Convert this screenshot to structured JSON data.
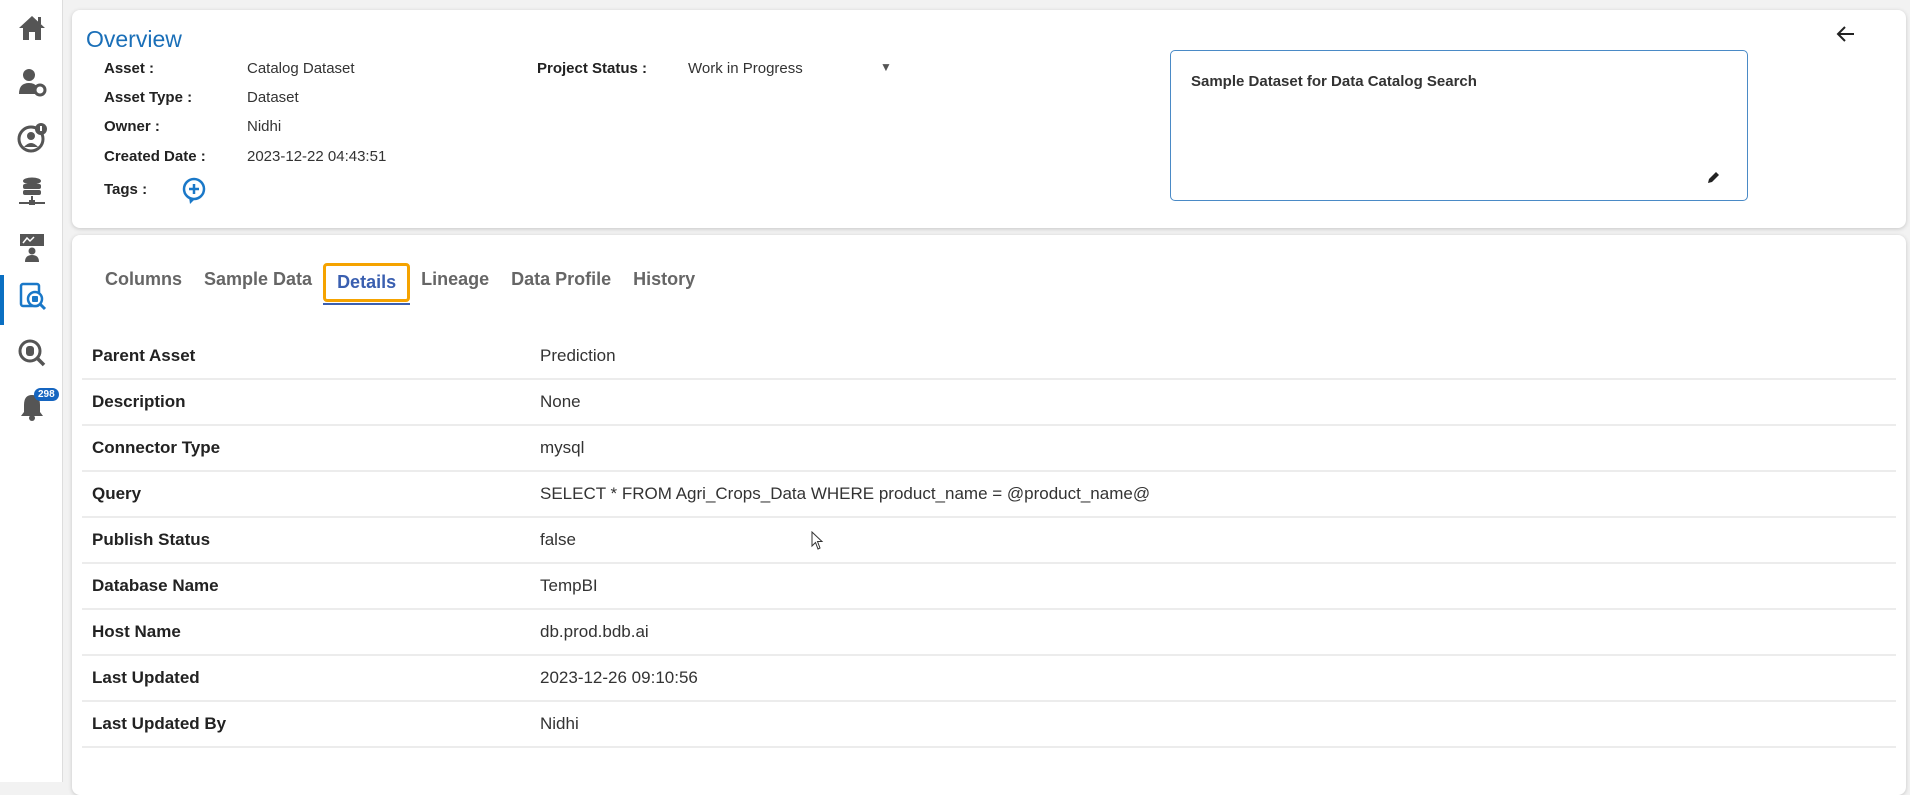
{
  "sidebar": {
    "items": [
      {
        "name": "home-icon"
      },
      {
        "name": "user-settings-icon"
      },
      {
        "name": "user-alert-icon"
      },
      {
        "name": "database-network-icon"
      },
      {
        "name": "dashboard-presenter-icon"
      },
      {
        "name": "data-catalog-icon",
        "active": true
      },
      {
        "name": "data-search-icon"
      },
      {
        "name": "notification-bell-icon"
      }
    ],
    "notification_count": "298"
  },
  "overview": {
    "title": "Overview",
    "asset_label": "Asset :",
    "asset_value": "Catalog Dataset",
    "asset_type_label": "Asset Type :",
    "asset_type_value": "Dataset",
    "owner_label": "Owner :",
    "owner_value": "Nidhi",
    "created_label": "Created Date :",
    "created_value": "2023-12-22 04:43:51",
    "tags_label": "Tags :",
    "project_status_label": "Project Status :",
    "project_status_value": "Work in Progress",
    "description_text": "Sample Dataset for Data Catalog Search"
  },
  "tabs": [
    "Columns",
    "Sample Data",
    "Details",
    "Lineage",
    "Data Profile",
    "History"
  ],
  "active_tab": "Details",
  "details": [
    {
      "key": "Parent Asset",
      "value": "Prediction"
    },
    {
      "key": "Description",
      "value": "None"
    },
    {
      "key": "Connector Type",
      "value": "mysql"
    },
    {
      "key": "Query",
      "value": "SELECT * FROM Agri_Crops_Data WHERE product_name = @product_name@"
    },
    {
      "key": "Publish Status",
      "value": "false"
    },
    {
      "key": "Database Name",
      "value": "TempBI"
    },
    {
      "key": "Host Name",
      "value": "db.prod.bdb.ai"
    },
    {
      "key": "Last Updated",
      "value": "2023-12-26 09:10:56"
    },
    {
      "key": "Last Updated By",
      "value": "Nidhi"
    }
  ],
  "colors": {
    "accent": "#1a6fb8",
    "tab_highlight": "#f5a300",
    "active_tab_text": "#3a5fb0"
  }
}
